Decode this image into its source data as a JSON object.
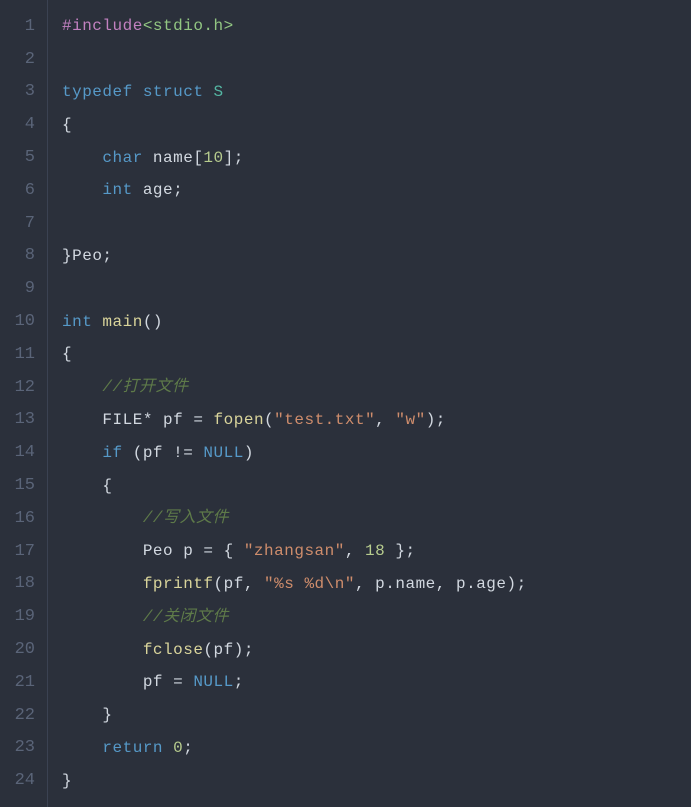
{
  "code": {
    "lineCount": 24,
    "lineNumbers": [
      "1",
      "2",
      "3",
      "4",
      "5",
      "6",
      "7",
      "8",
      "9",
      "10",
      "11",
      "12",
      "13",
      "14",
      "15",
      "16",
      "17",
      "18",
      "19",
      "20",
      "21",
      "22",
      "23",
      "24"
    ],
    "lines": [
      [
        {
          "cls": "tk-preproc",
          "t": "#include"
        },
        {
          "cls": "tk-angle",
          "t": "<stdio.h>"
        }
      ],
      [],
      [
        {
          "cls": "tk-keyword",
          "t": "typedef"
        },
        {
          "cls": "tk-ident",
          "t": " "
        },
        {
          "cls": "tk-keyword",
          "t": "struct"
        },
        {
          "cls": "tk-ident",
          "t": " "
        },
        {
          "cls": "tk-struct",
          "t": "S"
        }
      ],
      [
        {
          "cls": "tk-punct",
          "t": "{"
        }
      ],
      [
        {
          "cls": "tk-ident",
          "t": "    "
        },
        {
          "cls": "tk-type",
          "t": "char"
        },
        {
          "cls": "tk-ident",
          "t": " name["
        },
        {
          "cls": "tk-num",
          "t": "10"
        },
        {
          "cls": "tk-ident",
          "t": "];"
        }
      ],
      [
        {
          "cls": "tk-ident",
          "t": "    "
        },
        {
          "cls": "tk-type",
          "t": "int"
        },
        {
          "cls": "tk-ident",
          "t": " age;"
        }
      ],
      [],
      [
        {
          "cls": "tk-punct",
          "t": "}"
        },
        {
          "cls": "tk-ident",
          "t": "Peo;"
        }
      ],
      [],
      [
        {
          "cls": "tk-type",
          "t": "int"
        },
        {
          "cls": "tk-ident",
          "t": " "
        },
        {
          "cls": "tk-func",
          "t": "main"
        },
        {
          "cls": "tk-punct",
          "t": "()"
        }
      ],
      [
        {
          "cls": "tk-punct",
          "t": "{"
        }
      ],
      [
        {
          "cls": "tk-ident",
          "t": "    "
        },
        {
          "cls": "tk-comment",
          "t": "//打开文件"
        }
      ],
      [
        {
          "cls": "tk-ident",
          "t": "    "
        },
        {
          "cls": "tk-ident",
          "t": "FILE* pf = "
        },
        {
          "cls": "tk-func",
          "t": "fopen"
        },
        {
          "cls": "tk-punct",
          "t": "("
        },
        {
          "cls": "tk-str",
          "t": "\"test.txt\""
        },
        {
          "cls": "tk-punct",
          "t": ", "
        },
        {
          "cls": "tk-str",
          "t": "\"w\""
        },
        {
          "cls": "tk-punct",
          "t": ");"
        }
      ],
      [
        {
          "cls": "tk-ident",
          "t": "    "
        },
        {
          "cls": "tk-keyword",
          "t": "if"
        },
        {
          "cls": "tk-ident",
          "t": " (pf != "
        },
        {
          "cls": "tk-null",
          "t": "NULL"
        },
        {
          "cls": "tk-punct",
          "t": ")"
        }
      ],
      [
        {
          "cls": "tk-ident",
          "t": "    "
        },
        {
          "cls": "tk-punct",
          "t": "{"
        }
      ],
      [
        {
          "cls": "tk-ident",
          "t": "        "
        },
        {
          "cls": "tk-comment",
          "t": "//写入文件"
        }
      ],
      [
        {
          "cls": "tk-ident",
          "t": "        "
        },
        {
          "cls": "tk-ident",
          "t": "Peo p = { "
        },
        {
          "cls": "tk-str",
          "t": "\"zhangsan\""
        },
        {
          "cls": "tk-punct",
          "t": ", "
        },
        {
          "cls": "tk-num",
          "t": "18"
        },
        {
          "cls": "tk-punct",
          "t": " };"
        }
      ],
      [
        {
          "cls": "tk-ident",
          "t": "        "
        },
        {
          "cls": "tk-func",
          "t": "fprintf"
        },
        {
          "cls": "tk-punct",
          "t": "(pf, "
        },
        {
          "cls": "tk-str",
          "t": "\"%s %d\\n\""
        },
        {
          "cls": "tk-punct",
          "t": ", p.name, p.age);"
        }
      ],
      [
        {
          "cls": "tk-ident",
          "t": "        "
        },
        {
          "cls": "tk-comment",
          "t": "//关闭文件"
        }
      ],
      [
        {
          "cls": "tk-ident",
          "t": "        "
        },
        {
          "cls": "tk-func",
          "t": "fclose"
        },
        {
          "cls": "tk-punct",
          "t": "(pf);"
        }
      ],
      [
        {
          "cls": "tk-ident",
          "t": "        "
        },
        {
          "cls": "tk-ident",
          "t": "pf = "
        },
        {
          "cls": "tk-null",
          "t": "NULL"
        },
        {
          "cls": "tk-punct",
          "t": ";"
        }
      ],
      [
        {
          "cls": "tk-ident",
          "t": "    "
        },
        {
          "cls": "tk-punct",
          "t": "}"
        }
      ],
      [
        {
          "cls": "tk-ident",
          "t": "    "
        },
        {
          "cls": "tk-keyword",
          "t": "return"
        },
        {
          "cls": "tk-ident",
          "t": " "
        },
        {
          "cls": "tk-num",
          "t": "0"
        },
        {
          "cls": "tk-punct",
          "t": ";"
        }
      ],
      [
        {
          "cls": "tk-punct",
          "t": "}"
        }
      ]
    ]
  }
}
